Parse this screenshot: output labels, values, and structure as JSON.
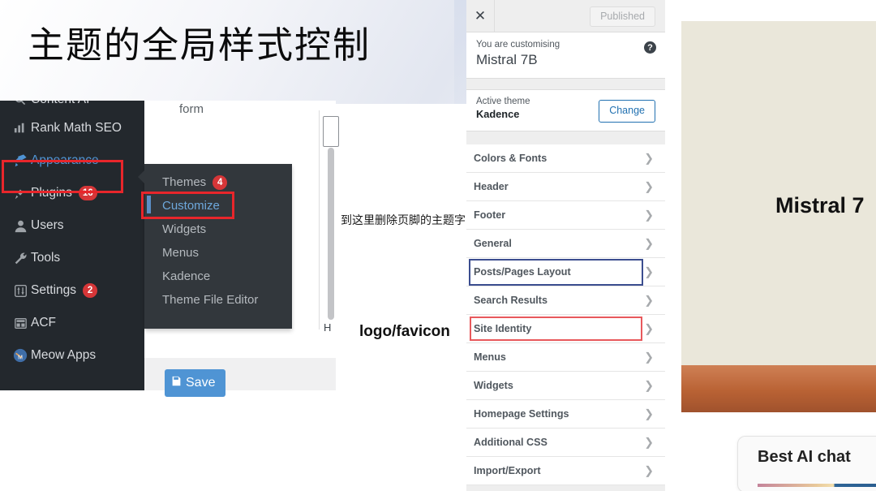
{
  "banner": {
    "title": "主题的全局样式控制"
  },
  "wp_sidebar": {
    "cut_item": {
      "label": "Content AI",
      "icon": "search-icon"
    },
    "items": [
      {
        "label": "Rank Math SEO",
        "icon": "rank-math-icon",
        "badge": ""
      },
      {
        "label": "Appearance",
        "icon": "paintbrush-icon",
        "badge": ""
      },
      {
        "label": "Plugins",
        "icon": "plug-icon",
        "badge": "16"
      },
      {
        "label": "Users",
        "icon": "user-icon",
        "badge": ""
      },
      {
        "label": "Tools",
        "icon": "wrench-icon",
        "badge": ""
      },
      {
        "label": "Settings",
        "icon": "sliders-icon",
        "badge": "2"
      },
      {
        "label": "ACF",
        "icon": "acf-grid-icon",
        "badge": ""
      },
      {
        "label": "Meow Apps",
        "icon": "meow-apps-icon",
        "badge": ""
      }
    ]
  },
  "wp_submenu": {
    "items": [
      {
        "label": "Themes",
        "badge": "4"
      },
      {
        "label": "Customize",
        "badge": ""
      },
      {
        "label": "Widgets",
        "badge": ""
      },
      {
        "label": "Menus",
        "badge": ""
      },
      {
        "label": "Kadence",
        "badge": ""
      },
      {
        "label": "Theme File Editor",
        "badge": ""
      }
    ]
  },
  "editor": {
    "form_text": "form",
    "save_label": "Save",
    "save_icon": "floppy-disk-icon",
    "panel_letter": "H"
  },
  "annotations": {
    "footer_note": "到这里删除页脚的主题字眼",
    "logo_favicon": "logo/favicon"
  },
  "customizer": {
    "close_icon": "close-icon",
    "published_label": "Published",
    "customising_label": "You are customising",
    "site_title": "Mistral 7B",
    "help_icon": "help-icon",
    "active_theme_label": "Active theme",
    "active_theme_name": "Kadence",
    "change_label": "Change",
    "sections": [
      {
        "label": "Colors & Fonts",
        "state": "normal"
      },
      {
        "label": "Header",
        "state": "normal"
      },
      {
        "label": "Footer",
        "state": "normal"
      },
      {
        "label": "General",
        "state": "normal"
      },
      {
        "label": "Posts/Pages Layout",
        "state": "focused"
      },
      {
        "label": "Search Results",
        "state": "normal"
      },
      {
        "label": "Site Identity",
        "state": "annotated"
      },
      {
        "label": "Menus",
        "state": "normal"
      },
      {
        "label": "Widgets",
        "state": "normal"
      },
      {
        "label": "Homepage Settings",
        "state": "normal"
      },
      {
        "label": "Additional CSS",
        "state": "normal"
      },
      {
        "label": "Import/Export",
        "state": "normal"
      }
    ],
    "chevron_icon": "chevron-right-icon"
  },
  "preview": {
    "hero_title": "Mistral 7",
    "card_title": "Best AI chat"
  },
  "colors": {
    "wp_sidebar_bg": "#23282d",
    "wp_submenu_bg": "#32373c",
    "wp_link_blue": "#4f94d4",
    "badge_red": "#d63638",
    "annotation_red": "#e8262b",
    "focus_blue": "#3b4d8f",
    "preview_cream": "#eae7da",
    "preview_orange": "#a0522d"
  }
}
